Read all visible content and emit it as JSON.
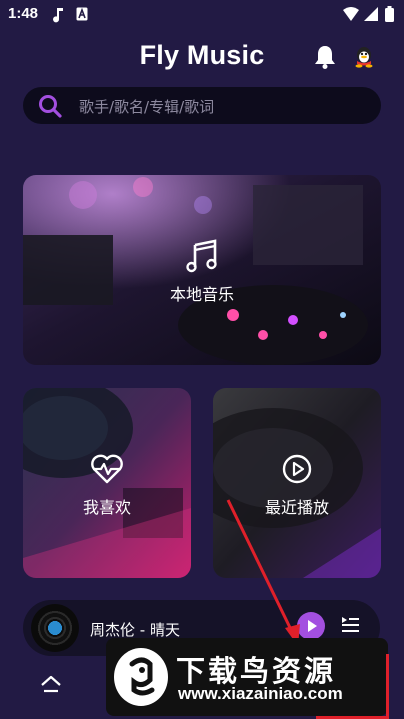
{
  "status_bar": {
    "time": "1:48"
  },
  "header": {
    "title": "Fly Music"
  },
  "search": {
    "placeholder": "歌手/歌名/专辑/歌词"
  },
  "cards": {
    "local": "本地音乐",
    "favorites": "我喜欢",
    "recent": "最近播放"
  },
  "player": {
    "now_playing": "周杰伦 - 晴天"
  },
  "watermark": {
    "brand": "下载鸟资源",
    "url": "www.xiazainiao.com"
  },
  "colors": {
    "background": "#221a44",
    "accent": "#a34fe0",
    "search_icon": "#a34fe0"
  }
}
